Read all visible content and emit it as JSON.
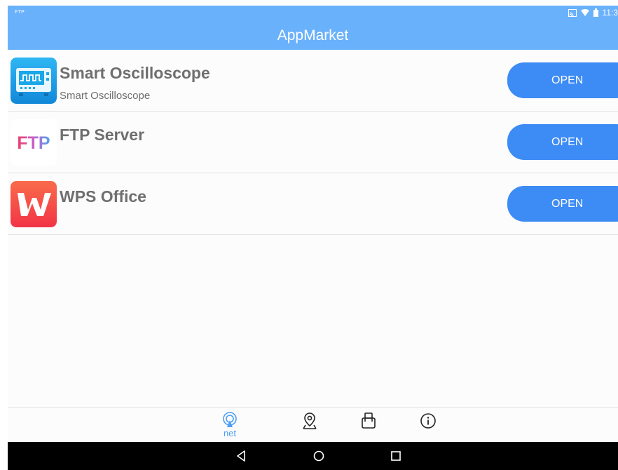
{
  "status_bar": {
    "left_text": "FTP",
    "time": "11:3",
    "icons": [
      "cast-icon",
      "wifi-icon",
      "battery-icon"
    ]
  },
  "header": {
    "title": "AppMarket"
  },
  "apps": [
    {
      "name": "Smart Oscilloscope",
      "subtitle": "Smart Oscilloscope",
      "button": "OPEN",
      "icon": "oscilloscope-icon"
    },
    {
      "name": "FTP Server",
      "subtitle": "",
      "button": "OPEN",
      "icon": "ftp-logo",
      "icon_text": "FTP"
    },
    {
      "name": "WPS Office",
      "subtitle": "",
      "button": "OPEN",
      "icon": "wps-office-icon"
    }
  ],
  "bottom_nav": [
    {
      "icon": "net-icon",
      "label": "net",
      "active": true
    },
    {
      "icon": "location-icon",
      "label": "",
      "active": false
    },
    {
      "icon": "usb-drive-icon",
      "label": "",
      "active": false
    },
    {
      "icon": "info-icon",
      "label": "",
      "active": false
    }
  ],
  "system_nav": [
    "back-icon",
    "home-icon",
    "recents-icon"
  ],
  "colors": {
    "header": "#6ab1fb",
    "button": "#3d8bf4",
    "nav_active": "#4e9ef5",
    "text": "#6f6f6f"
  }
}
